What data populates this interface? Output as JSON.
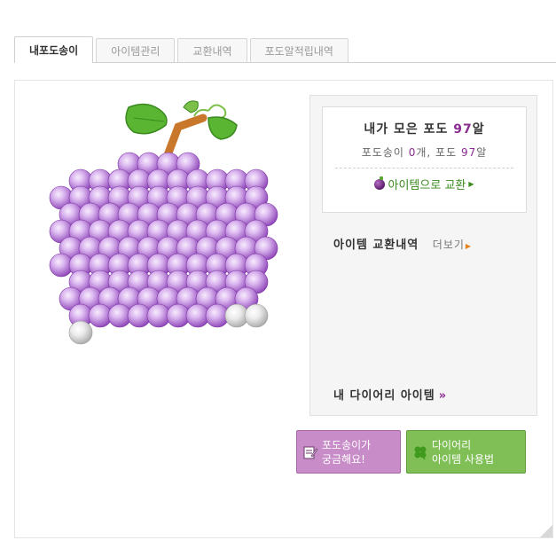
{
  "tabs": [
    {
      "label": "내포도송이",
      "active": true
    },
    {
      "label": "아이템관리",
      "active": false
    },
    {
      "label": "교환내역",
      "active": false
    },
    {
      "label": "포도알적립내역",
      "active": false
    }
  ],
  "summary": {
    "collected_prefix": "내가 모은 포도 ",
    "collected_count": "97",
    "collected_suffix": "알",
    "breakdown_a": "포도송이 ",
    "bunch_count": "0",
    "breakdown_b": "개, 포도 ",
    "grape_count": "97",
    "breakdown_c": "알",
    "exchange_link": "아이템으로 교환"
  },
  "history": {
    "title": "아이템 교환내역",
    "more_label": "더보기"
  },
  "my_items": {
    "label": "내 다이어리 아이템",
    "arrow": "»"
  },
  "buttons": {
    "faq_line1": "포도송이가",
    "faq_line2": "궁금해요!",
    "guide_line1": "다이어리",
    "guide_line2": "아이템 사용법"
  },
  "grape": {
    "filled_count": 97,
    "empty_count": 3,
    "colors": {
      "filled_light": "#dcb8f0",
      "filled_dark": "#8a3fb5",
      "empty_light": "#f4f4f4",
      "empty_dark": "#a8a8a8",
      "leaf": "#5ab532",
      "stem": "#c9772a"
    }
  },
  "colors": {
    "accent_purple": "#8b2c92",
    "link_green": "#3a8a1f",
    "button_purple": "#c88cc8",
    "button_green": "#7fbf56"
  }
}
